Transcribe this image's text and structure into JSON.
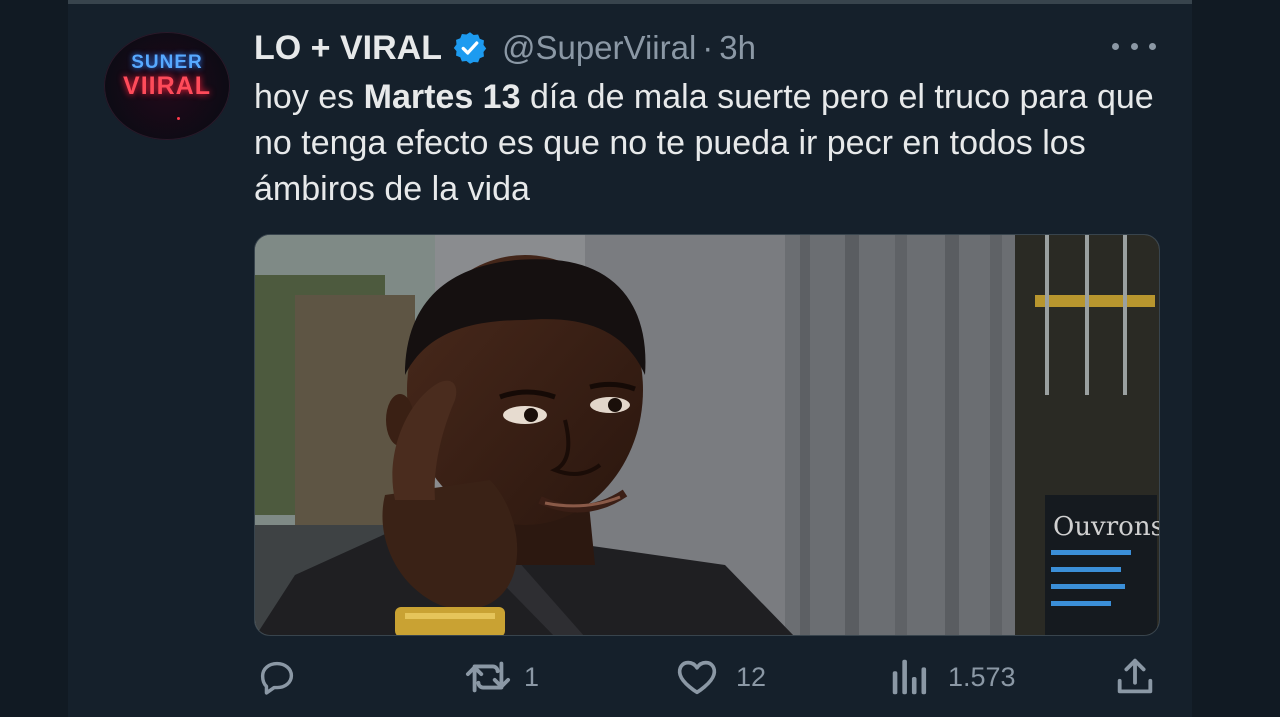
{
  "account": {
    "display_name": "LO + VIRAL",
    "handle": "@SuperViiral",
    "separator": "·",
    "time": "3h",
    "avatar_line1": "SUNER",
    "avatar_line2": "VIIRAL"
  },
  "tweet": {
    "text_before": "hoy es ",
    "text_bold": "Martes 13",
    "text_after": " día de mala suerte pero el truco para que no tenga efecto es que no te pueda ir pecr en todos los ámbiros de la vida",
    "image_sign_text": "Ouvrons"
  },
  "actions": {
    "replies": "",
    "retweets": "1",
    "likes": "12",
    "views": "1.573"
  },
  "icons": {
    "verified": "verified-badge-icon",
    "more": "more-options-icon",
    "reply": "reply-icon",
    "retweet": "retweet-icon",
    "like": "heart-icon",
    "views": "views-chart-icon",
    "share": "share-icon"
  },
  "colors": {
    "background": "#15202b",
    "text": "#e7e9ea",
    "muted": "#8b98a5",
    "verified": "#1d9bf0"
  }
}
